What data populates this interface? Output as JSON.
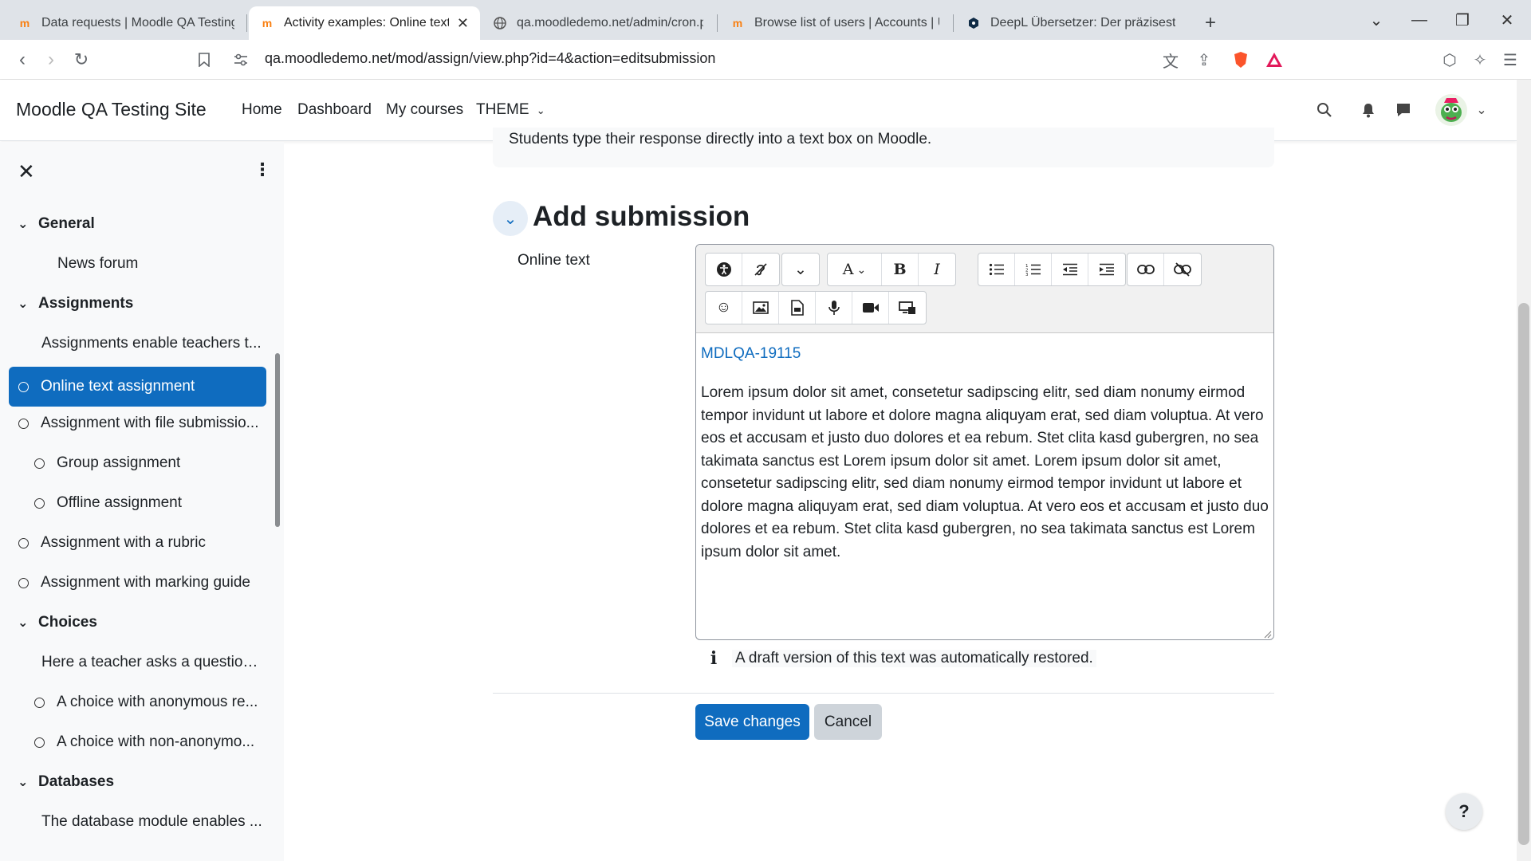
{
  "browser": {
    "tabs": [
      {
        "title": "Data requests | Moodle QA Testing",
        "icon": "moodle-icon"
      },
      {
        "title": "Activity examples: Online text a",
        "icon": "moodle-icon"
      },
      {
        "title": "qa.moodledemo.net/admin/cron.ph",
        "icon": "globe-icon"
      },
      {
        "title": "Browse list of users | Accounts | Use",
        "icon": "moodle-icon"
      },
      {
        "title": "DeepL Übersetzer: Der präziseste Ü",
        "icon": "deepl-icon"
      }
    ],
    "url": "qa.moodledemo.net/mod/assign/view.php?id=4&action=editsubmission"
  },
  "navbar": {
    "site_name": "Moodle QA Testing Site",
    "links": [
      "Home",
      "Dashboard",
      "My courses",
      "THEME"
    ]
  },
  "drawer": {
    "sections": [
      {
        "label": "General"
      },
      {
        "label": "Assignments"
      },
      {
        "label": "Choices"
      },
      {
        "label": "Databases"
      }
    ],
    "items": [
      {
        "label": "News forum"
      },
      {
        "label": "Assignments enable teachers t..."
      },
      {
        "label": "Online text assignment"
      },
      {
        "label": "Assignment with file submissio..."
      },
      {
        "label": "Group assignment"
      },
      {
        "label": "Offline assignment"
      },
      {
        "label": "Assignment with a rubric"
      },
      {
        "label": "Assignment with marking guide"
      },
      {
        "label": "Here a teacher asks a question ..."
      },
      {
        "label": "A choice with anonymous re..."
      },
      {
        "label": "A choice with non-anonymo..."
      },
      {
        "label": "The database module enables ..."
      }
    ]
  },
  "main": {
    "intro_text": "Students type their response directly into a text box on Moodle.",
    "section_title": "Add submission",
    "field_label": "Online text",
    "editor": {
      "reference": "MDLQA-19115",
      "body": "Lorem ipsum dolor sit amet, consetetur sadipscing elitr, sed diam nonumy eirmod tempor invidunt ut labore et dolore magna aliquyam erat, sed diam voluptua. At vero eos et accusam et justo duo dolores et ea rebum. Stet clita kasd gubergren, no sea takimata sanctus est Lorem ipsum dolor sit amet. Lorem ipsum dolor sit amet, consetetur sadipscing elitr, sed diam nonumy eirmod tempor invidunt ut labore et dolore magna aliquyam erat, sed diam voluptua. At vero eos et accusam et justo duo dolores et ea rebum. Stet clita kasd gubergren, no sea takimata sanctus est Lorem ipsum dolor sit amet."
    },
    "notice": "A draft version of this text was automatically restored.",
    "save_label": "Save changes",
    "cancel_label": "Cancel",
    "help_label": "?"
  },
  "colors": {
    "primary": "#0f6cbf",
    "drawer_bg": "#f8f9fa"
  }
}
